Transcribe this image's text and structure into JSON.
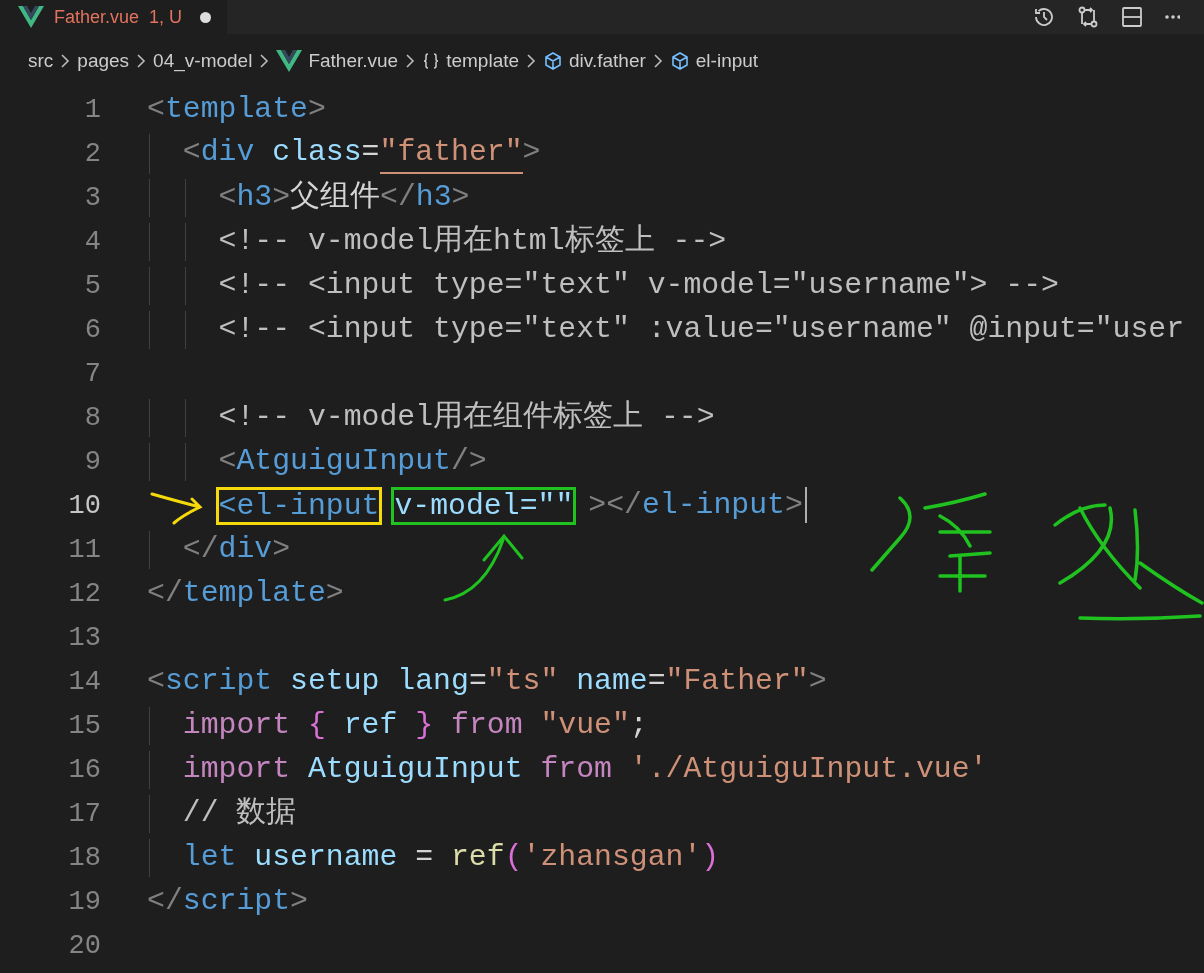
{
  "tab": {
    "title": "Father.vue",
    "status": "1, U",
    "modified": true
  },
  "breadcrumbs": [
    {
      "label": "src",
      "kind": "folder"
    },
    {
      "label": "pages",
      "kind": "folder"
    },
    {
      "label": "04_v-model",
      "kind": "folder"
    },
    {
      "label": "Father.vue",
      "kind": "vue"
    },
    {
      "label": "template",
      "kind": "braces"
    },
    {
      "label": "div.father",
      "kind": "element"
    },
    {
      "label": "el-input",
      "kind": "element"
    }
  ],
  "lines": [
    {
      "n": "1",
      "current": false,
      "tokens": [
        {
          "t": "<",
          "kind": "punct"
        },
        {
          "t": "template",
          "kind": "tag"
        },
        {
          "t": ">",
          "kind": "punct"
        }
      ]
    },
    {
      "n": "2",
      "current": false,
      "tokens": [
        {
          "t": "  <",
          "kind": "punct"
        },
        {
          "t": "div",
          "kind": "tag"
        },
        {
          "t": " class",
          "kind": "attr"
        },
        {
          "t": "=",
          "kind": "plain"
        },
        {
          "t": "\"father\"",
          "kind": "string",
          "underline": true
        },
        {
          "t": ">",
          "kind": "punct"
        }
      ]
    },
    {
      "n": "3",
      "current": false,
      "tokens": [
        {
          "t": "    <",
          "kind": "punct"
        },
        {
          "t": "h3",
          "kind": "tag"
        },
        {
          "t": ">",
          "kind": "punct"
        },
        {
          "t": "父组件",
          "kind": "plain"
        },
        {
          "t": "</",
          "kind": "punct"
        },
        {
          "t": "h3",
          "kind": "tag"
        },
        {
          "t": ">",
          "kind": "punct"
        }
      ]
    },
    {
      "n": "4",
      "current": false,
      "tokens": [
        {
          "t": "    <!-- v-model用在html标签上 -->",
          "kind": "comment"
        }
      ]
    },
    {
      "n": "5",
      "current": false,
      "tokens": [
        {
          "t": "    <!-- <input type=\"text\" v-model=\"username\"> -->",
          "kind": "comment"
        }
      ]
    },
    {
      "n": "6",
      "current": false,
      "tokens": [
        {
          "t": "    <!-- <input type=\"text\" :value=\"username\" @input=\"user",
          "kind": "comment"
        }
      ]
    },
    {
      "n": "7",
      "current": false
    },
    {
      "n": "8",
      "current": false,
      "tokens": [
        {
          "t": "    <!-- v-model用在组件标签上 -->",
          "kind": "comment"
        }
      ]
    },
    {
      "n": "9",
      "current": false,
      "tokens": [
        {
          "t": "    <",
          "kind": "punct"
        },
        {
          "t": "AtguiguInput",
          "kind": "tag"
        },
        {
          "t": "/>",
          "kind": "punct"
        }
      ]
    },
    {
      "n": "10",
      "current": true,
      "tokens": [
        {
          "t": "    <el-input",
          "kind": "tag",
          "color": "#f5d90a"
        },
        {
          "t": "v-model=\"\"",
          "kind": "attr",
          "color": "#1fc21f"
        },
        {
          "t": "></",
          "kind": "punct"
        },
        {
          "t": "el-input",
          "kind": "tag"
        },
        {
          "t": ">",
          "kind": "punct"
        }
      ]
    },
    {
      "n": "11",
      "current": false,
      "tokens": [
        {
          "t": "  </",
          "kind": "punct"
        },
        {
          "t": "div",
          "kind": "tag"
        },
        {
          "t": ">",
          "kind": "punct"
        }
      ]
    },
    {
      "n": "12",
      "current": false,
      "tokens": [
        {
          "t": "</",
          "kind": "punct"
        },
        {
          "t": "template",
          "kind": "tag"
        },
        {
          "t": ">",
          "kind": "punct"
        }
      ]
    },
    {
      "n": "13",
      "current": false
    },
    {
      "n": "14",
      "current": false,
      "tokens": [
        {
          "t": "<",
          "kind": "punct"
        },
        {
          "t": "script",
          "kind": "tag"
        },
        {
          "t": " setup lang",
          "kind": "attr"
        },
        {
          "t": "=",
          "kind": "plain"
        },
        {
          "t": "\"ts\"",
          "kind": "string"
        },
        {
          "t": " name",
          "kind": "attr"
        },
        {
          "t": "=",
          "kind": "plain"
        },
        {
          "t": "\"Father\"",
          "kind": "string"
        },
        {
          "t": ">",
          "kind": "punct"
        }
      ]
    },
    {
      "n": "15",
      "current": false,
      "tokens": [
        {
          "t": "  import",
          "kind": "keyword"
        },
        {
          "t": " {",
          "kind": "brace"
        },
        {
          "t": " ref",
          "kind": "var"
        },
        {
          "t": " }",
          "kind": "brace"
        },
        {
          "t": " from",
          "kind": "keyword"
        },
        {
          "t": " \"vue\"",
          "kind": "string"
        },
        {
          "t": ";",
          "kind": "plain"
        }
      ]
    },
    {
      "n": "16",
      "current": false,
      "tokens": [
        {
          "t": "  import",
          "kind": "keyword"
        },
        {
          "t": " AtguiguInput",
          "kind": "var"
        },
        {
          "t": " from",
          "kind": "keyword"
        },
        {
          "t": " './AtguiguInput.vue'",
          "kind": "string"
        }
      ]
    },
    {
      "n": "17",
      "current": false,
      "tokens": [
        {
          "t": "  // 数据",
          "kind": "comment"
        }
      ]
    },
    {
      "n": "18",
      "current": false,
      "tokens": [
        {
          "t": "  let",
          "kind": "storage"
        },
        {
          "t": " username",
          "kind": "var"
        },
        {
          "t": " =",
          "kind": "plain"
        },
        {
          "t": " ref",
          "kind": "func"
        },
        {
          "t": "(",
          "kind": "brace"
        },
        {
          "t": "'zhansgan'",
          "kind": "string"
        },
        {
          "t": ")",
          "kind": "brace"
        }
      ]
    },
    {
      "n": "19",
      "current": false,
      "tokens": [
        {
          "t": "</",
          "kind": "punct"
        },
        {
          "t": "script",
          "kind": "tag"
        },
        {
          "t": ">",
          "kind": "punct"
        }
      ]
    },
    {
      "n": "20",
      "current": false
    }
  ]
}
